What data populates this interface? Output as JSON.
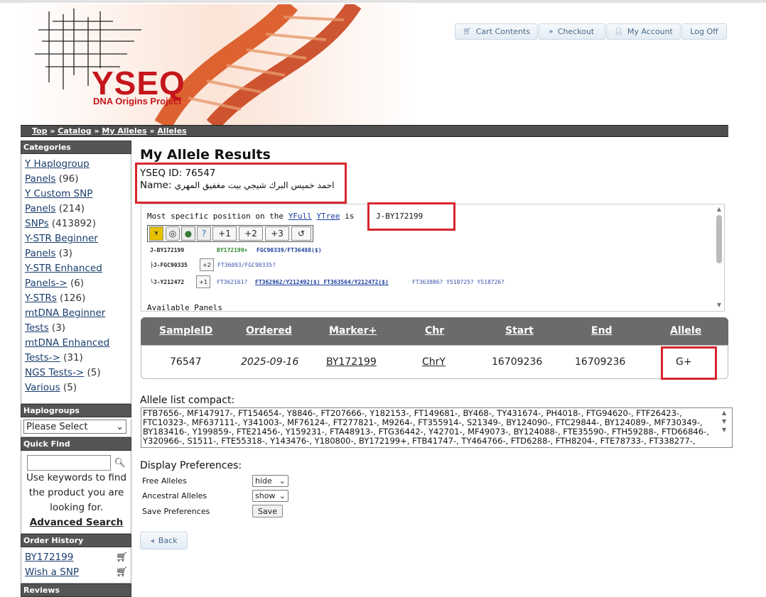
{
  "header": {
    "logo_title": "YSEQ",
    "logo_subtitle": "DNA Origins Project",
    "buttons": [
      "Cart Contents",
      "Checkout",
      "My Account",
      "Log Off"
    ]
  },
  "breadcrumb": [
    "Top",
    "Catalog",
    "My Alleles",
    "Alleles"
  ],
  "sidebar": {
    "categories_title": "Categories",
    "categories": [
      {
        "label": "Y Haplogroup",
        "label2": "Panels",
        "count": "(96)"
      },
      {
        "label": "Y Custom SNP",
        "label2": "Panels",
        "count": "(214)"
      },
      {
        "label": "SNPs",
        "count": "(413892)"
      },
      {
        "label": "Y-STR Beginner",
        "label2": "Panels",
        "count": "(3)"
      },
      {
        "label": "Y-STR Enhanced",
        "label2": "Panels->",
        "count": "(6)"
      },
      {
        "label": "Y-STRs",
        "count": "(126)"
      },
      {
        "label": "mtDNA Beginner",
        "label2": "Tests",
        "count": "(3)"
      },
      {
        "label": "mtDNA Enhanced",
        "label2": "Tests->",
        "count": "(31)"
      },
      {
        "label": "NGS Tests->",
        "count": "(5)"
      },
      {
        "label": "Various",
        "count": "(5)"
      }
    ],
    "haplogroups_title": "Haplogroups",
    "haplogroups_select": "Please Select",
    "quickfind_title": "Quick Find",
    "quickfind_help": "Use keywords to find the product you are looking for.",
    "advanced_search": "Advanced Search",
    "order_history_title": "Order History",
    "order_history": [
      "BY172199",
      "Wish a SNP"
    ],
    "reviews_title": "Reviews"
  },
  "main": {
    "title": "My Allele Results",
    "yseq_id_label": "YSEQ ID:",
    "yseq_id": "76547",
    "name_label": "Name:",
    "name": "احمد خميس البرك شيجي بيت مغفيق المهري",
    "position_text_pre": "Most specific position on the",
    "yfull_link": "YFull",
    "ytree_link": "YTree",
    "position_text_is": "is",
    "position_value": "J-BY172199",
    "tree_buttons": [
      "+1",
      "+2",
      "+3",
      "↺"
    ],
    "tree_rows": [
      {
        "node": "J-BY172199",
        "snps_green": "BY172199+",
        "snps_blue": "FGC90339/FT36488($)"
      },
      {
        "node": "├J-FGC90335",
        "btn": "+2",
        "snps_blue": "FT36093/FGC90335?"
      },
      {
        "node": "└J-Y212472",
        "btn": "+1",
        "snps_blue": "FT362161?",
        "snps_bold": "FT362962/Y212492($) FT363564/Y212472($)",
        "snps_rest": "FT363886? Y518725? Y518726?"
      }
    ],
    "available_panels": "Available Panels"
  },
  "table": {
    "headers": [
      "SampleID",
      "Ordered",
      "Marker+",
      "Chr",
      "Start",
      "End",
      "Allele"
    ],
    "row": {
      "sample_id": "76547",
      "ordered": "2025-09-16",
      "marker": "BY172199",
      "chr": "ChrY",
      "start": "16709236",
      "end": "16709236",
      "allele": "G+"
    }
  },
  "compact": {
    "label": "Allele list compact:",
    "text": "FTB7656-, MF147917-, FT154654-, Y8846-, FT207666-, Y182153-, FT149681-, BY468-, TY431674-, PH4018-, FTG94620-, FTF26423-, FTC10323-, MF637111-, Y341003-, MF76124-, FT277821-, M9264-, FT355914-, S21349-, BY124090-, FTC29844-, BY124089-, MF730349-, BY183416-, Y199859-, FTE21456-, Y159231-, FTA48913-, FTG36442-, Y42701-, MF49073-, BY124088-, FTE35590-, FTH59288-, FTD66846-, Y320966-, S1511-, FTE55318-, Y143476-, Y180800-, BY172199+, FTB41747-, TY464766-, FTD6288-, FTH8204-, FTE78733-, FT338277-,"
  },
  "preferences": {
    "title": "Display Preferences:",
    "free_alleles_label": "Free Alleles",
    "free_alleles_value": "hide",
    "ancestral_label": "Ancestral Alleles",
    "ancestral_value": "show",
    "save_label": "Save Preferences",
    "save_button": "Save"
  },
  "back_button": "Back",
  "colors": {
    "accent_red": "#d7262e",
    "header_gray": "#6b6b6b",
    "link_blue": "#1a3e6e",
    "logo_red": "#c4161c"
  }
}
